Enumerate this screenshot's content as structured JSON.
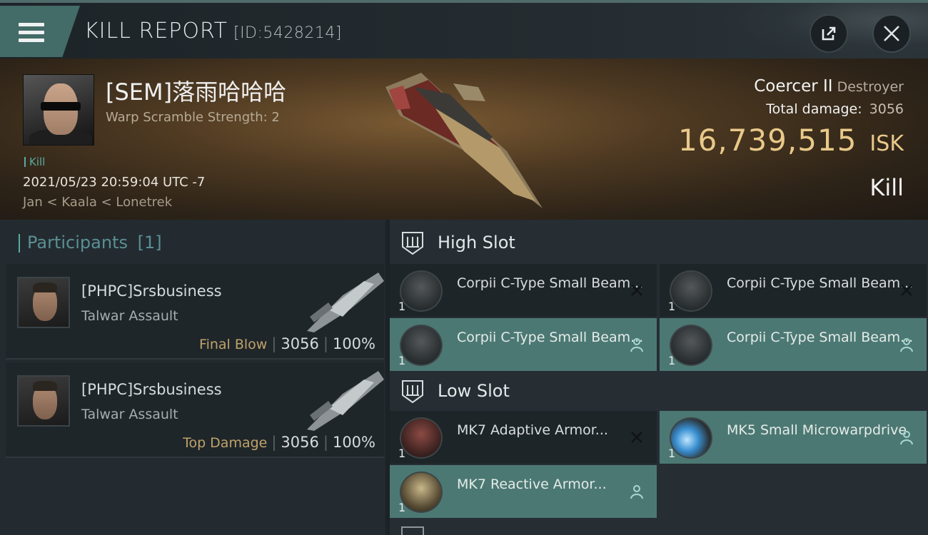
{
  "header": {
    "title": "KILL REPORT",
    "report_id": "[ID:5428214]",
    "menu_icon": "hamburger-menu-icon",
    "share_icon": "external-link-icon",
    "close_icon": "close-icon"
  },
  "victim": {
    "name": "[SEM]落雨哈哈哈",
    "subtitle": "Warp Scramble Strength: 2",
    "tag": "Kill",
    "datetime": "2021/05/23 20:59:04 UTC -7",
    "location": "Jan < Kaala < Lonetrek",
    "ship_name": "Coercer II",
    "ship_class": "Destroyer",
    "total_damage_label": "Total damage:",
    "total_damage_value": "3056",
    "isk_value": "16,739,515",
    "isk_unit": "ISK",
    "result": "Kill"
  },
  "participants": {
    "title": "Participants",
    "count": "[1]",
    "rows": [
      {
        "name": "[PHPC]Srsbusiness",
        "ship": "Talwar Assault",
        "label": "Final Blow",
        "damage": "3056",
        "percent": "100%"
      },
      {
        "name": "[PHPC]Srsbusiness",
        "ship": "Talwar Assault",
        "label": "Top Damage",
        "damage": "3056",
        "percent": "100%"
      }
    ]
  },
  "fitting": {
    "high_slot": {
      "title": "High Slot",
      "modules": [
        {
          "name": "Corpii C-Type Small Beam...",
          "qty": "1",
          "state": "destroyed"
        },
        {
          "name": "Corpii C-Type Small Beam...",
          "qty": "1",
          "state": "destroyed"
        },
        {
          "name": "Corpii C-Type Small Beam...",
          "qty": "1",
          "state": "dropped"
        },
        {
          "name": "Corpii C-Type Small Beam...",
          "qty": "1",
          "state": "dropped"
        }
      ]
    },
    "low_slot": {
      "title": "Low Slot",
      "modules": [
        {
          "name": "MK7 Adaptive Armor...",
          "qty": "1",
          "state": "destroyed"
        },
        {
          "name": "MK5 Small Microwarpdrive",
          "qty": "1",
          "state": "dropped"
        },
        {
          "name": "MK7 Reactive Armor...",
          "qty": "1",
          "state": "dropped"
        }
      ]
    }
  },
  "colors": {
    "accent_teal": "#4c7873",
    "isk_gold": "#e9c98a",
    "final_blow_gold": "#bfa26a"
  }
}
